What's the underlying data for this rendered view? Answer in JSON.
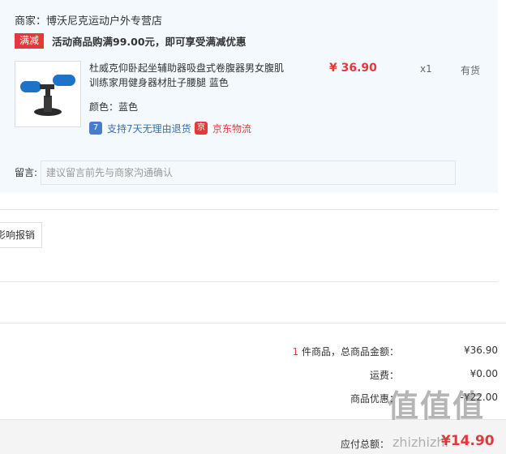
{
  "shop": {
    "name": "商家：博沃尼克运动户外专营店",
    "promo_tag": "满减",
    "promo_text": "活动商品购满99.00元，即可享受满减优惠"
  },
  "product": {
    "title": "杜威克仰卧起坐辅助器吸盘式卷腹器男女腹肌训练家用健身器材肚子腰腿 蓝色",
    "price": "¥ 36.90",
    "qty": "x1",
    "stock": "有货",
    "color": "颜色：蓝色",
    "service_return_badge": "7",
    "service_return": "支持7天无理由退货",
    "service_ship_badge": "京",
    "service_ship": "京东物流"
  },
  "note": {
    "label": "留言:",
    "placeholder": "建议留言前先与商家沟通确认"
  },
  "invoice": {
    "label": "影响报销"
  },
  "summary": {
    "count_num": "1",
    "count_text": " 件商品，总商品金额：",
    "total": "¥36.90",
    "shipping_label": "运费：",
    "shipping": "¥0.00",
    "discount_label": "商品优惠：",
    "discount": "-¥22.00"
  },
  "payable": {
    "label": "应付总额：",
    "value": "¥14.90"
  },
  "watermark": {
    "main": "值值值",
    "sub": "zhizhizhi"
  }
}
